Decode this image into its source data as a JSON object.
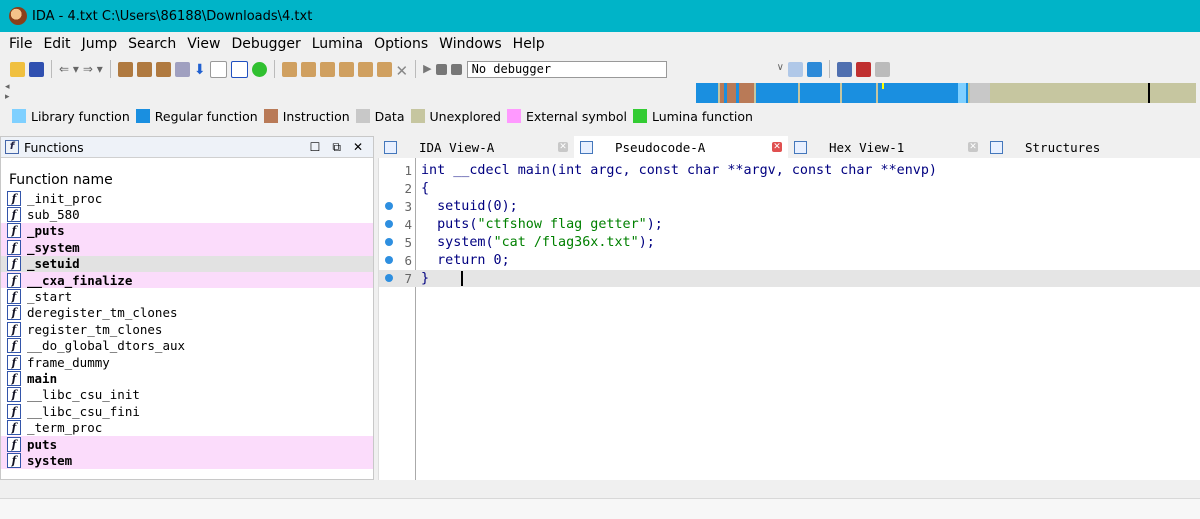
{
  "window": {
    "title": "IDA - 4.txt C:\\Users\\86188\\Downloads\\4.txt"
  },
  "menu": [
    "File",
    "Edit",
    "Jump",
    "Search",
    "View",
    "Debugger",
    "Lumina",
    "Options",
    "Windows",
    "Help"
  ],
  "toolbar": {
    "debugger_value": "No debugger"
  },
  "legend": [
    {
      "label": "Library function",
      "color": "#7fd0ff"
    },
    {
      "label": "Regular function",
      "color": "#1a8fe0"
    },
    {
      "label": "Instruction",
      "color": "#b97a57"
    },
    {
      "label": "Data",
      "color": "#c8c8c8"
    },
    {
      "label": "Unexplored",
      "color": "#c6c6a0"
    },
    {
      "label": "External symbol",
      "color": "#ff99ff"
    },
    {
      "label": "Lumina function",
      "color": "#33cc33"
    }
  ],
  "functions_pane": {
    "title": "Functions",
    "column_header": "Function name",
    "items": [
      {
        "name": "_init_proc",
        "style": "normal"
      },
      {
        "name": "sub_580",
        "style": "normal"
      },
      {
        "name": "_puts",
        "style": "pink-bold"
      },
      {
        "name": "_system",
        "style": "pink-bold"
      },
      {
        "name": "_setuid",
        "style": "gray-bold"
      },
      {
        "name": "__cxa_finalize",
        "style": "pink-bold"
      },
      {
        "name": "_start",
        "style": "normal"
      },
      {
        "name": "deregister_tm_clones",
        "style": "normal"
      },
      {
        "name": "register_tm_clones",
        "style": "normal"
      },
      {
        "name": "__do_global_dtors_aux",
        "style": "normal"
      },
      {
        "name": "frame_dummy",
        "style": "normal"
      },
      {
        "name": "main",
        "style": "bold"
      },
      {
        "name": "__libc_csu_init",
        "style": "normal"
      },
      {
        "name": "__libc_csu_fini",
        "style": "normal"
      },
      {
        "name": "_term_proc",
        "style": "normal"
      },
      {
        "name": "puts",
        "style": "pink-bold"
      },
      {
        "name": "system",
        "style": "pink-bold"
      }
    ]
  },
  "tabs": [
    {
      "label": "IDA View-A",
      "active": false
    },
    {
      "label": "Pseudocode-A",
      "active": true
    },
    {
      "label": "Hex View-1",
      "active": false
    },
    {
      "label": "Structures",
      "active": false
    }
  ],
  "code": {
    "lines": [
      {
        "n": "1",
        "dot": false,
        "text": "int __cdecl main(int argc, const char **argv, const char **envp)"
      },
      {
        "n": "2",
        "dot": false,
        "text": "{"
      },
      {
        "n": "3",
        "dot": true,
        "text": "  setuid(0);"
      },
      {
        "n": "4",
        "dot": true,
        "text": "  puts(\"ctfshow flag getter\");"
      },
      {
        "n": "5",
        "dot": true,
        "text": "  system(\"cat /flag36x.txt\");"
      },
      {
        "n": "6",
        "dot": true,
        "text": "  return 0;"
      },
      {
        "n": "7",
        "dot": true,
        "text": "}"
      }
    ]
  }
}
